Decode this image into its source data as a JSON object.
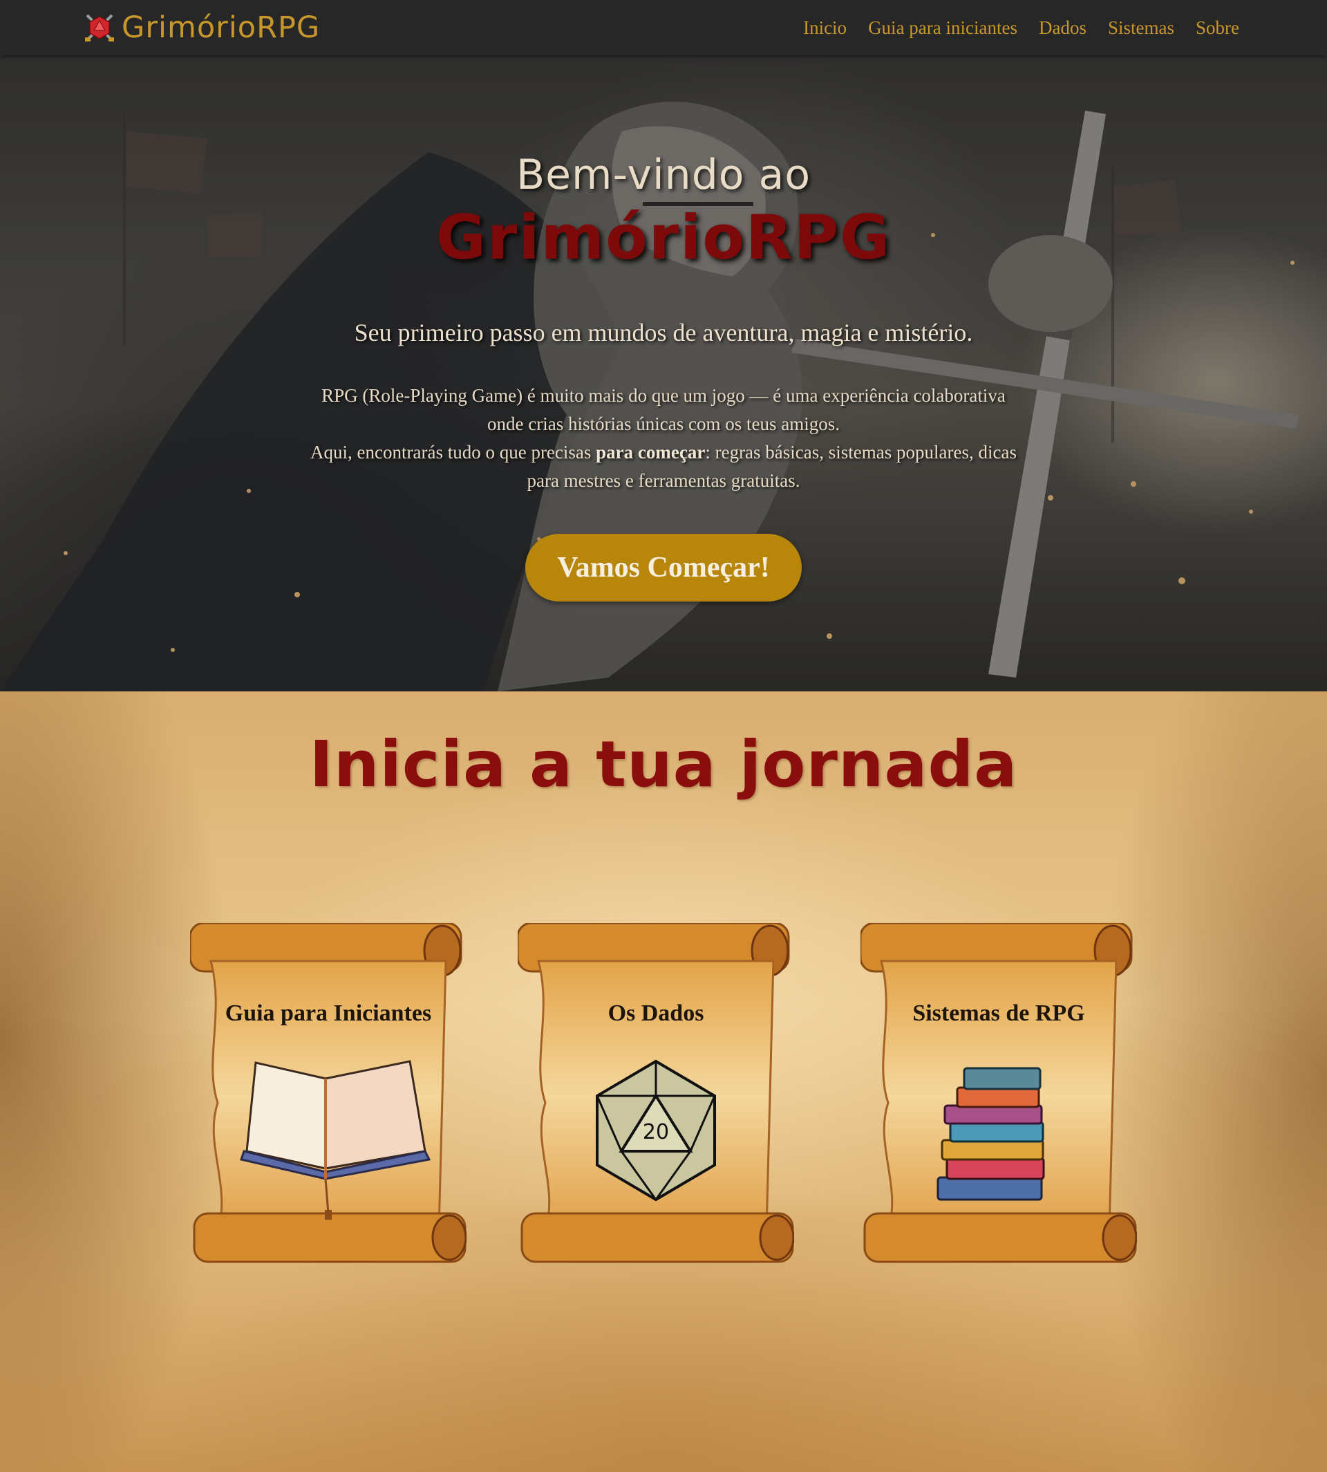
{
  "navbar": {
    "brand": "GrimórioRPG",
    "links": [
      "Inicio",
      "Guia para iniciantes",
      "Dados",
      "Sistemas",
      "Sobre"
    ]
  },
  "hero": {
    "welcome": "Bem-vindo ao",
    "title": "GrimórioRPG",
    "subtitle": "Seu primeiro passo em mundos de aventura, magia e mistério.",
    "desc_line1": "RPG (Role-Playing Game) é muito mais do que um jogo — é uma experiência colaborativa onde crias histórias únicas com os teus amigos.",
    "desc_line2_before": "Aqui, encontrarás tudo o que precisas ",
    "desc_line2_bold": "para começar",
    "desc_line2_after": ": regras básicas, sistemas populares, dicas para mestres e ferramentas gratuitas.",
    "button": "Vamos Começar!"
  },
  "journey": {
    "title": "Inicia a tua jornada",
    "cards": [
      {
        "title": "Guia para Iniciantes",
        "icon": "open-book-icon"
      },
      {
        "title": "Os Dados",
        "icon": "d20-dice-icon"
      },
      {
        "title": "Sistemas de RPG",
        "icon": "book-stack-icon"
      }
    ]
  },
  "colors": {
    "navbar_bg": "#272727",
    "nav_text": "#c8972c",
    "hero_title": "#7d0a0a",
    "button_bg": "#b8860b",
    "journey_title": "#8b0e0e"
  }
}
